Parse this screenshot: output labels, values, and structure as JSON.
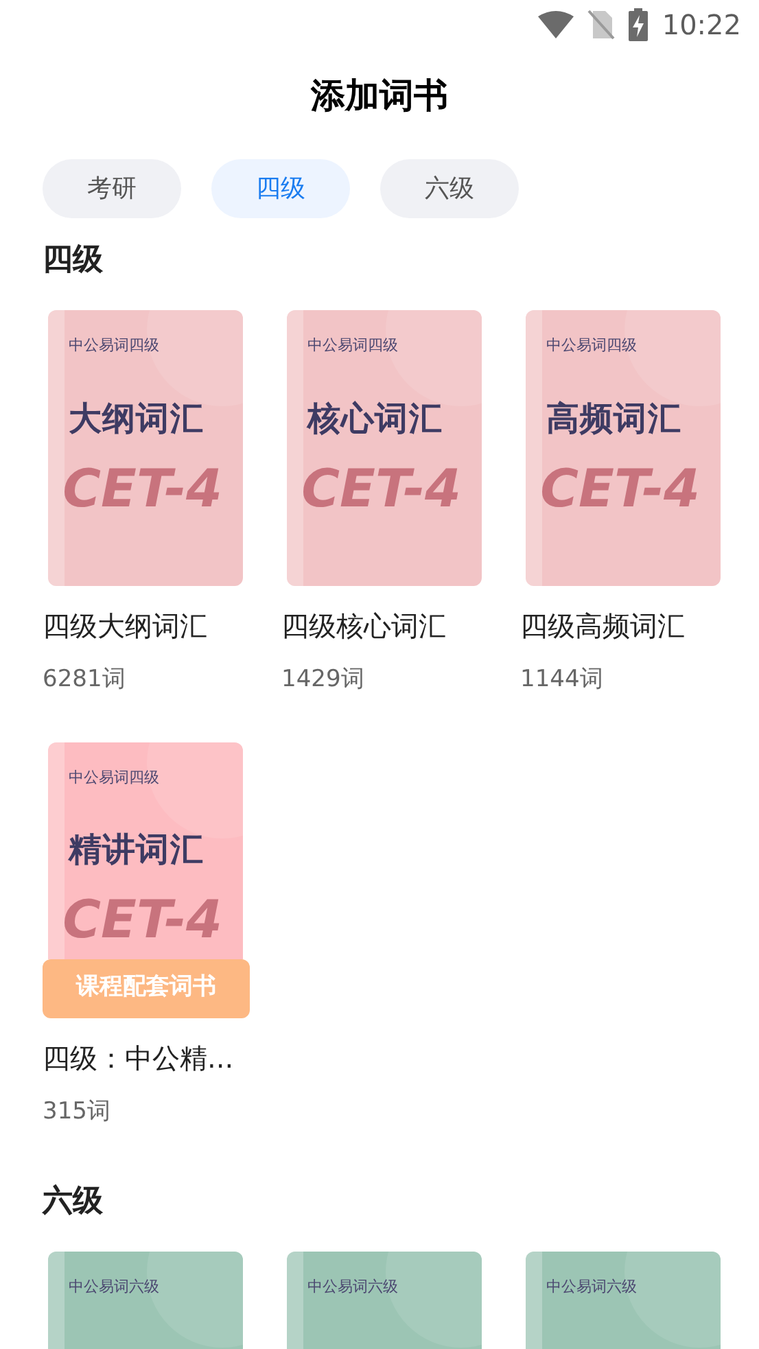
{
  "status_bar": {
    "time": "10:22"
  },
  "title": "添加词书",
  "tabs": [
    {
      "label": "考研",
      "selected": false
    },
    {
      "label": "四级",
      "selected": true
    },
    {
      "label": "六级",
      "selected": false
    }
  ],
  "sections": [
    {
      "heading": "四级",
      "books": [
        {
          "cover": {
            "series": "中公易词四级",
            "title": "大纲词汇",
            "mark": "CET-4",
            "color": "#f2c4c6"
          },
          "name": "四级大纲词汇",
          "count": "6281词"
        },
        {
          "cover": {
            "series": "中公易词四级",
            "title": "核心词汇",
            "mark": "CET-4",
            "color": "#f2c4c6"
          },
          "name": "四级核心词汇",
          "count": "1429词"
        },
        {
          "cover": {
            "series": "中公易词四级",
            "title": "高频词汇",
            "mark": "CET-4",
            "color": "#f2c4c6"
          },
          "name": "四级高频词汇",
          "count": "1144词"
        },
        {
          "cover": {
            "series": "中公易词四级",
            "title": "精讲词汇",
            "mark": "CET-4",
            "color": "#fdbcc1"
          },
          "badge": "课程配套词书",
          "name": "四级：中公精...",
          "count": "315词"
        }
      ]
    },
    {
      "heading": "六级",
      "books": [
        {
          "cover": {
            "series": "中公易词六级",
            "color": "#9cc5b4"
          }
        },
        {
          "cover": {
            "series": "中公易词六级",
            "color": "#9cc5b4"
          }
        },
        {
          "cover": {
            "series": "中公易词六级",
            "color": "#9cc5b4"
          }
        }
      ]
    }
  ]
}
